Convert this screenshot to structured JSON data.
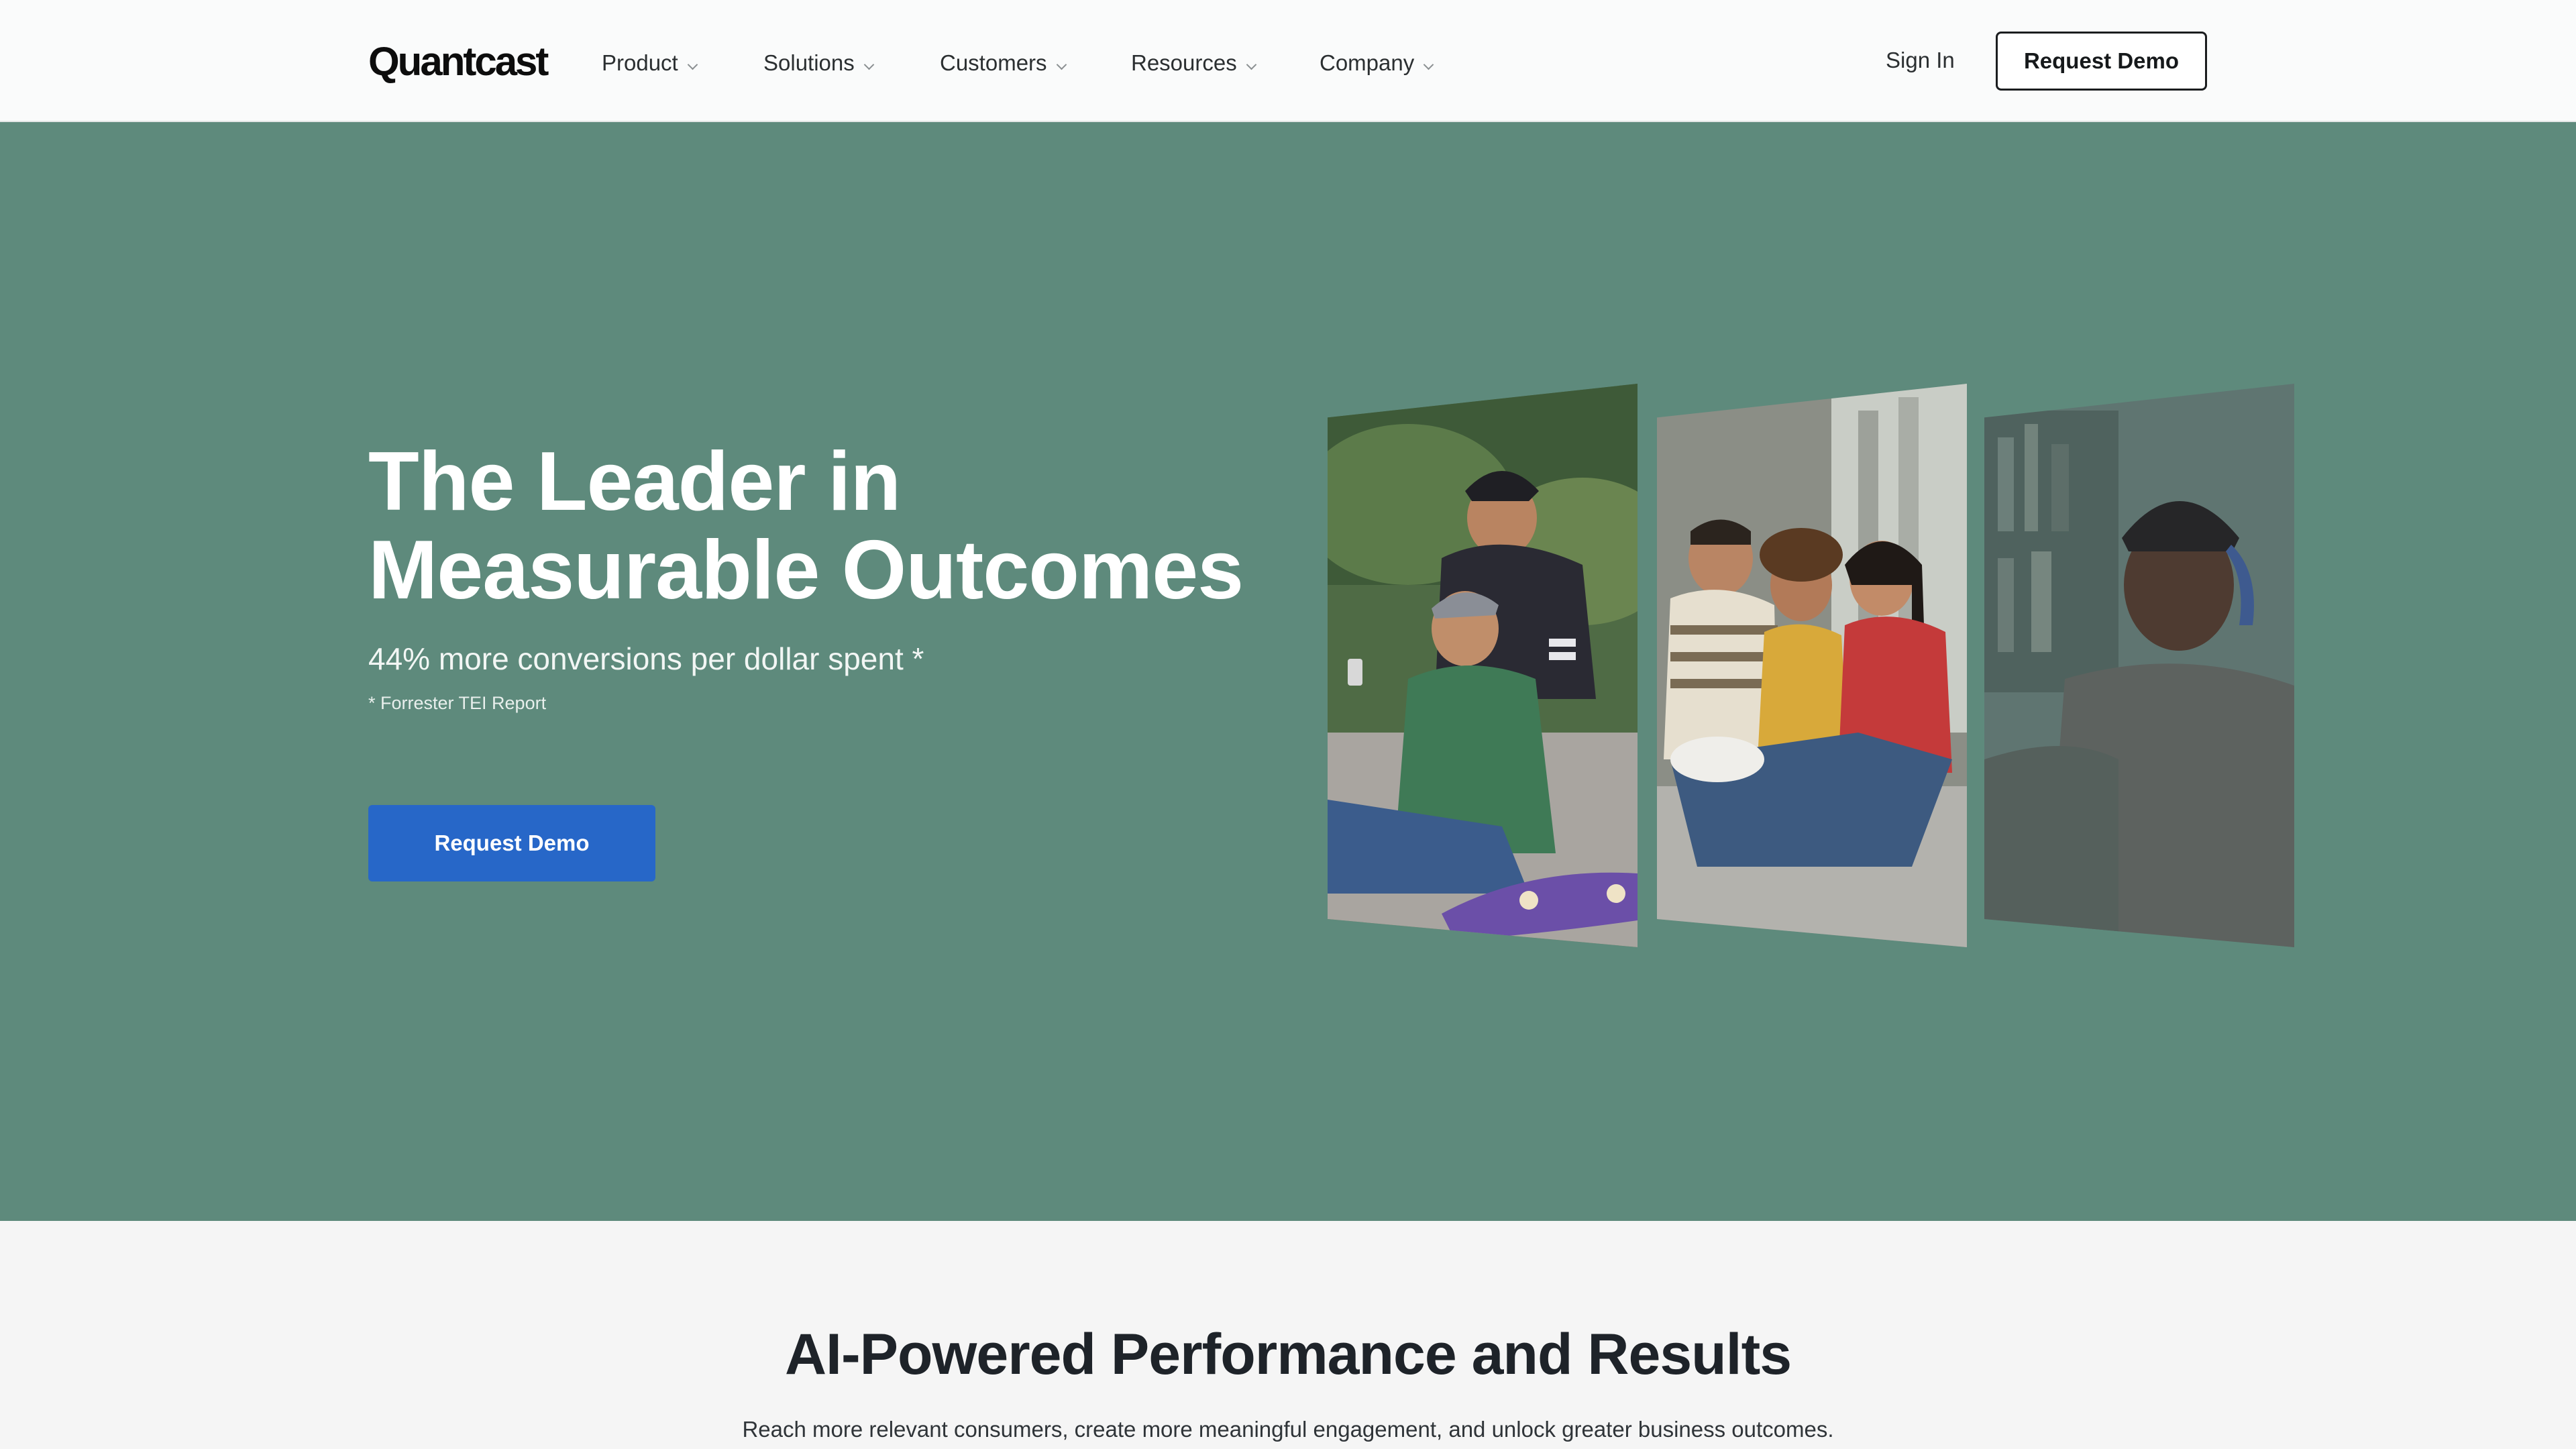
{
  "header": {
    "logo": "Quantcast",
    "nav": [
      {
        "label": "Product"
      },
      {
        "label": "Solutions"
      },
      {
        "label": "Customers"
      },
      {
        "label": "Resources"
      },
      {
        "label": "Company"
      }
    ],
    "sign_in": "Sign In",
    "request_demo": "Request Demo"
  },
  "hero": {
    "title_line1": "The Leader in",
    "title_line2": "Measurable Outcomes",
    "subtitle": "44% more conversions per dollar spent *",
    "footnote": "* Forrester TEI Report",
    "cta": "Request Demo",
    "background": "#5e8a7c",
    "cta_color": "#2767c8"
  },
  "section": {
    "title": "AI-Powered Performance and Results",
    "text": "Reach more relevant consumers, create more meaningful engagement, and unlock greater business outcomes."
  },
  "icons": [
    "chevron-down-icon"
  ]
}
